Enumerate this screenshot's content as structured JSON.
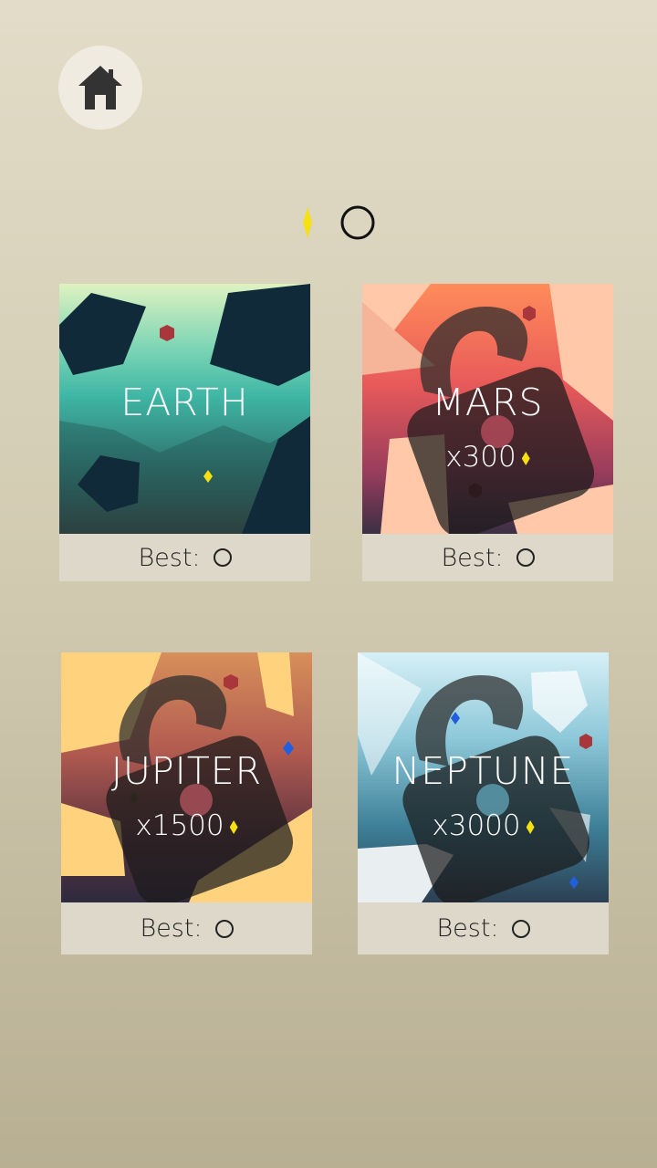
{
  "header": {
    "home_icon": "home-icon"
  },
  "currency": {
    "gem_icon": "gem-icon",
    "balance_icon": "zero-ring-icon"
  },
  "colors": {
    "gem": "#f5e012",
    "background": "#d3ccb3",
    "best_panel": "#ddd8c9"
  },
  "levels": [
    {
      "name": "EARTH",
      "cost": "",
      "locked": false,
      "best_label": "Best:"
    },
    {
      "name": "MARS",
      "cost": "x300",
      "locked": true,
      "best_label": "Best:"
    },
    {
      "name": "JUPITER",
      "cost": "x1500",
      "locked": true,
      "best_label": "Best:"
    },
    {
      "name": "NEPTUNE",
      "cost": "x3000",
      "locked": true,
      "best_label": "Best:"
    }
  ]
}
